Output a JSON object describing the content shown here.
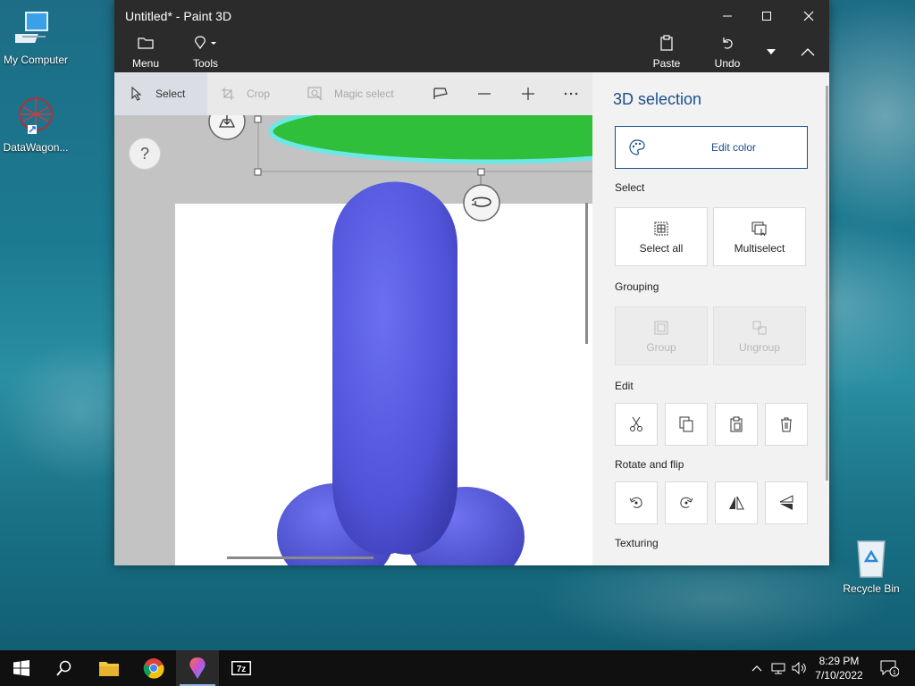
{
  "desktop": {
    "icons": [
      {
        "label": "My Computer"
      },
      {
        "label": "DataWagon..."
      },
      {
        "label": "Recycle Bin"
      }
    ]
  },
  "window": {
    "title": "Untitled* - Paint 3D",
    "commands": {
      "menu": "Menu",
      "tools": "Tools",
      "paste": "Paste",
      "undo": "Undo"
    }
  },
  "toolbar": {
    "select": "Select",
    "crop": "Crop",
    "magic_select": "Magic select"
  },
  "canvas": {
    "help": "?"
  },
  "panel": {
    "title": "3D selection",
    "edit_color": "Edit color",
    "select_heading": "Select",
    "select_all": "Select all",
    "multiselect": "Multiselect",
    "grouping_heading": "Grouping",
    "group": "Group",
    "ungroup": "Ungroup",
    "edit_heading": "Edit",
    "rotate_heading": "Rotate and flip",
    "texturing_heading": "Texturing"
  },
  "taskbar": {
    "time": "8:29 PM",
    "date": "7/10/2022",
    "notification_count": "1"
  },
  "colors": {
    "accent": "#1a4e8a",
    "object": "#5b5fe0",
    "green_object": "#2fbf3a"
  }
}
